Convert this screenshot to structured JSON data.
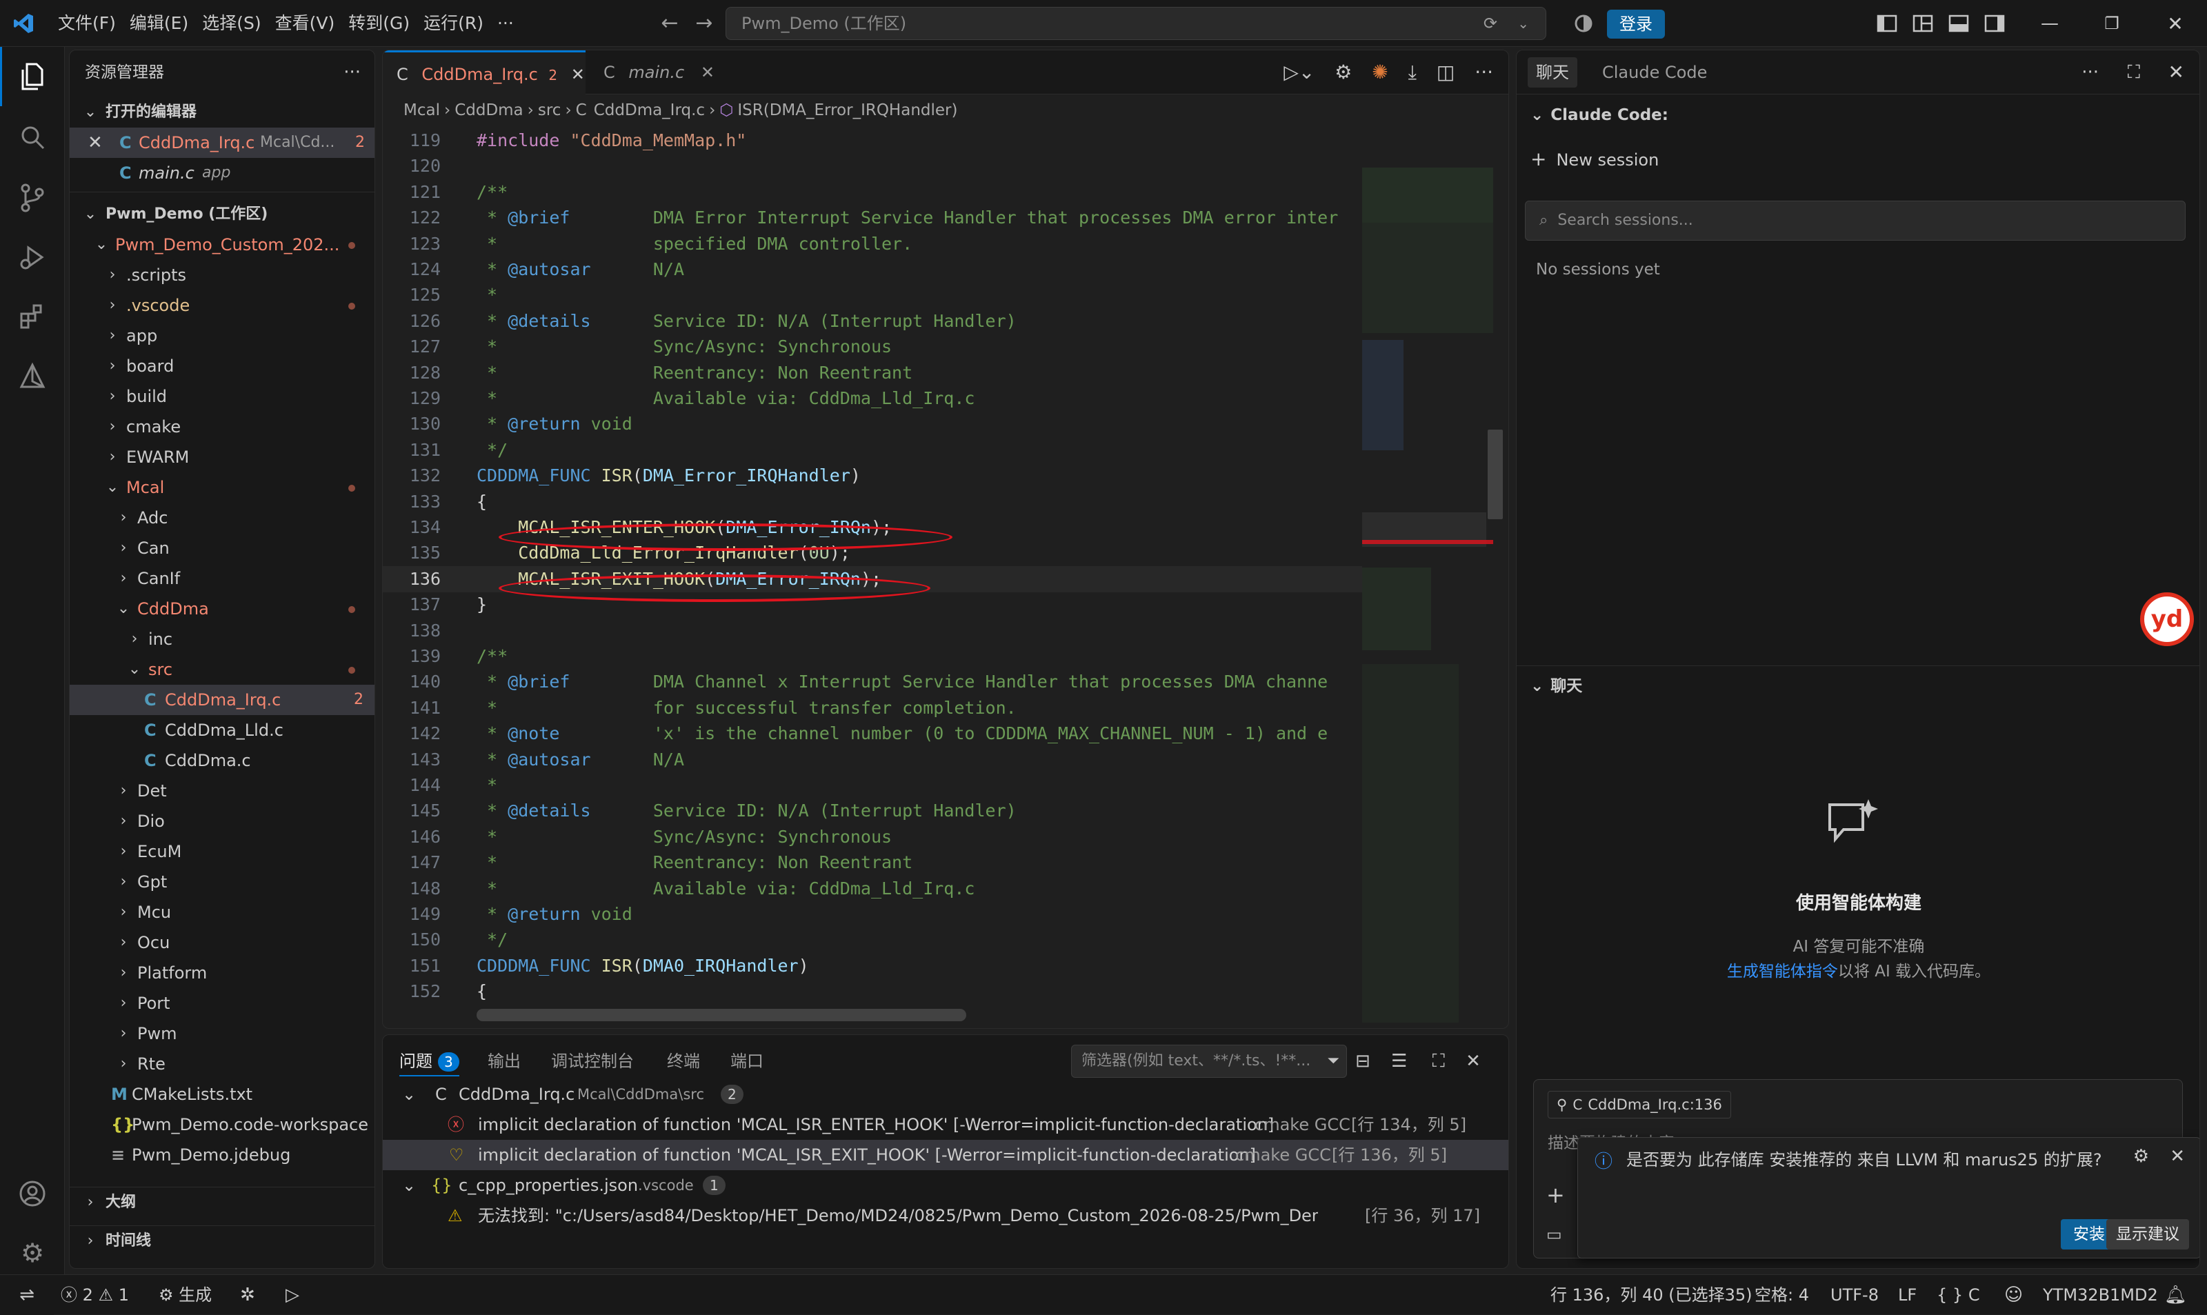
{
  "titlebar": {
    "menus": [
      "文件(F)",
      "编辑(E)",
      "选择(S)",
      "查看(V)",
      "转到(G)",
      "运行(R)",
      "···"
    ],
    "search": "Pwm_Demo (工作区)",
    "login": "登录"
  },
  "explorer": {
    "title": "资源管理器",
    "open_editors": "打开的编辑器",
    "open_items": [
      {
        "name": "CddDma_Irq.c",
        "path": "Mcal\\Cd...",
        "badge": "2"
      },
      {
        "name": "main.c",
        "path": "app"
      }
    ],
    "workspace": "Pwm_Demo (工作区)",
    "tree": [
      {
        "label": "Pwm_Demo_Custom_202...",
        "depth": 0,
        "open": true,
        "cls": "err",
        "dot": true
      },
      {
        "label": ".scripts",
        "depth": 1
      },
      {
        "label": ".vscode",
        "depth": 1,
        "cls": "mod",
        "dot": true
      },
      {
        "label": "app",
        "depth": 1
      },
      {
        "label": "board",
        "depth": 1
      },
      {
        "label": "build",
        "depth": 1
      },
      {
        "label": "cmake",
        "depth": 1
      },
      {
        "label": "EWARM",
        "depth": 1
      },
      {
        "label": "Mcal",
        "depth": 1,
        "open": true,
        "cls": "err",
        "dot": true
      },
      {
        "label": "Adc",
        "depth": 2
      },
      {
        "label": "Can",
        "depth": 2
      },
      {
        "label": "CanIf",
        "depth": 2
      },
      {
        "label": "CddDma",
        "depth": 2,
        "open": true,
        "cls": "err",
        "dot": true
      },
      {
        "label": "inc",
        "depth": 3
      },
      {
        "label": "src",
        "depth": 3,
        "open": true,
        "cls": "err",
        "dot": true
      },
      {
        "label": "CddDma_Irq.c",
        "depth": 4,
        "file": "c",
        "cls": "err",
        "badge": "2",
        "selected": true
      },
      {
        "label": "CddDma_Lld.c",
        "depth": 4,
        "file": "c"
      },
      {
        "label": "CddDma.c",
        "depth": 4,
        "file": "c"
      },
      {
        "label": "Det",
        "depth": 2
      },
      {
        "label": "Dio",
        "depth": 2
      },
      {
        "label": "EcuM",
        "depth": 2
      },
      {
        "label": "Gpt",
        "depth": 2
      },
      {
        "label": "Mcu",
        "depth": 2
      },
      {
        "label": "Ocu",
        "depth": 2
      },
      {
        "label": "Platform",
        "depth": 2
      },
      {
        "label": "Port",
        "depth": 2
      },
      {
        "label": "Pwm",
        "depth": 2
      },
      {
        "label": "Rte",
        "depth": 2
      },
      {
        "label": "CMakeLists.txt",
        "depth": 1,
        "file": "cmake"
      },
      {
        "label": "Pwm_Demo.code-workspace",
        "depth": 1,
        "file": "json"
      },
      {
        "label": "Pwm_Demo.jdebug",
        "depth": 1,
        "file": "txt"
      }
    ],
    "outline": "大纲",
    "timeline": "时间线"
  },
  "editor": {
    "tabs": [
      {
        "name": "CddDma_Irq.c",
        "badge": "2",
        "active": true
      },
      {
        "name": "main.c",
        "active": false
      }
    ],
    "breadcrumb": [
      "Mcal",
      "CddDma",
      "src",
      "CddDma_Irq.c",
      "ISR(DMA_Error_IRQHandler)"
    ],
    "current_line": "136",
    "lines": [
      {
        "n": "119",
        "t": [
          [
            "pp",
            "#include "
          ],
          [
            "str",
            "\"CddDma_MemMap.h\""
          ]
        ]
      },
      {
        "n": "120",
        "t": []
      },
      {
        "n": "121",
        "t": [
          [
            "cmt",
            "/**"
          ]
        ]
      },
      {
        "n": "122",
        "t": [
          [
            "cmt",
            " * "
          ],
          [
            "tag",
            "@brief"
          ],
          [
            "cmt",
            "        DMA Error Interrupt Service Handler that processes DMA error inter"
          ]
        ]
      },
      {
        "n": "123",
        "t": [
          [
            "cmt",
            " *               specified DMA controller."
          ]
        ]
      },
      {
        "n": "124",
        "t": [
          [
            "cmt",
            " * "
          ],
          [
            "tag",
            "@autosar"
          ],
          [
            "cmt",
            "      N/A"
          ]
        ]
      },
      {
        "n": "125",
        "t": [
          [
            "cmt",
            " *"
          ]
        ]
      },
      {
        "n": "126",
        "t": [
          [
            "cmt",
            " * "
          ],
          [
            "tag",
            "@details"
          ],
          [
            "cmt",
            "      Service ID: N/A (Interrupt Handler)"
          ]
        ]
      },
      {
        "n": "127",
        "t": [
          [
            "cmt",
            " *               Sync/Async: Synchronous"
          ]
        ]
      },
      {
        "n": "128",
        "t": [
          [
            "cmt",
            " *               Reentrancy: Non Reentrant"
          ]
        ]
      },
      {
        "n": "129",
        "t": [
          [
            "cmt",
            " *               Available via: CddDma_Lld_Irq.c"
          ]
        ]
      },
      {
        "n": "130",
        "t": [
          [
            "cmt",
            " * "
          ],
          [
            "tag",
            "@return"
          ],
          [
            "cmt",
            " void"
          ]
        ]
      },
      {
        "n": "131",
        "t": [
          [
            "cmt",
            " */"
          ]
        ]
      },
      {
        "n": "132",
        "t": [
          [
            "kw",
            "CDDDMA_FUNC "
          ],
          [
            "fn",
            "ISR"
          ],
          [
            "plain",
            "("
          ],
          [
            "id",
            "DMA_Error_IRQHandler"
          ],
          [
            "plain",
            ")"
          ]
        ]
      },
      {
        "n": "133",
        "t": [
          [
            "plain",
            "{"
          ]
        ]
      },
      {
        "n": "134",
        "t": [
          [
            "plain",
            "    "
          ],
          [
            "fn",
            "MCAL_ISR_ENTER_HOOK"
          ],
          [
            "plain",
            "("
          ],
          [
            "id",
            "DMA_Error_IRQn"
          ],
          [
            "plain",
            ");"
          ]
        ]
      },
      {
        "n": "135",
        "t": [
          [
            "plain",
            "    "
          ],
          [
            "fn",
            "CddDma_Lld_Error_IrqHandler"
          ],
          [
            "plain",
            "("
          ],
          [
            "num",
            "0U"
          ],
          [
            "plain",
            ");"
          ]
        ]
      },
      {
        "n": "136",
        "t": [
          [
            "plain",
            "    "
          ],
          [
            "fn",
            "MCAL_ISR_EXIT_HOOK"
          ],
          [
            "plain",
            "("
          ],
          [
            "id",
            "DMA_Error_IRQn"
          ],
          [
            "plain",
            ");"
          ]
        ]
      },
      {
        "n": "137",
        "t": [
          [
            "plain",
            "}"
          ]
        ]
      },
      {
        "n": "138",
        "t": []
      },
      {
        "n": "139",
        "t": [
          [
            "cmt",
            "/**"
          ]
        ]
      },
      {
        "n": "140",
        "t": [
          [
            "cmt",
            " * "
          ],
          [
            "tag",
            "@brief"
          ],
          [
            "cmt",
            "        DMA Channel x Interrupt Service Handler that processes DMA channe"
          ]
        ]
      },
      {
        "n": "141",
        "t": [
          [
            "cmt",
            " *               for successful transfer completion."
          ]
        ]
      },
      {
        "n": "142",
        "t": [
          [
            "cmt",
            " * "
          ],
          [
            "tag",
            "@note"
          ],
          [
            "cmt",
            "         'x' is the channel number (0 to CDDDMA_MAX_CHANNEL_NUM - 1) and e"
          ]
        ]
      },
      {
        "n": "143",
        "t": [
          [
            "cmt",
            " * "
          ],
          [
            "tag",
            "@autosar"
          ],
          [
            "cmt",
            "      N/A"
          ]
        ]
      },
      {
        "n": "144",
        "t": [
          [
            "cmt",
            " *"
          ]
        ]
      },
      {
        "n": "145",
        "t": [
          [
            "cmt",
            " * "
          ],
          [
            "tag",
            "@details"
          ],
          [
            "cmt",
            "      Service ID: N/A (Interrupt Handler)"
          ]
        ]
      },
      {
        "n": "146",
        "t": [
          [
            "cmt",
            " *               Sync/Async: Synchronous"
          ]
        ]
      },
      {
        "n": "147",
        "t": [
          [
            "cmt",
            " *               Reentrancy: Non Reentrant"
          ]
        ]
      },
      {
        "n": "148",
        "t": [
          [
            "cmt",
            " *               Available via: CddDma_Lld_Irq.c"
          ]
        ]
      },
      {
        "n": "149",
        "t": [
          [
            "cmt",
            " * "
          ],
          [
            "tag",
            "@return"
          ],
          [
            "cmt",
            " void"
          ]
        ]
      },
      {
        "n": "150",
        "t": [
          [
            "cmt",
            " */"
          ]
        ]
      },
      {
        "n": "151",
        "t": [
          [
            "kw",
            "CDDDMA_FUNC "
          ],
          [
            "fn",
            "ISR"
          ],
          [
            "plain",
            "("
          ],
          [
            "id",
            "DMA0_IRQHandler"
          ],
          [
            "plain",
            ")"
          ]
        ]
      },
      {
        "n": "152",
        "t": [
          [
            "plain",
            "{"
          ]
        ]
      }
    ]
  },
  "panel": {
    "tabs": [
      "问题",
      "输出",
      "调试控制台",
      "终端",
      "端口"
    ],
    "problem_count": "3",
    "filter_placeholder": "筛选器(例如 text、**/*.ts、!**...",
    "file1": {
      "name": "CddDma_Irq.c",
      "path": "Mcal\\CddDma\\src",
      "count": "2"
    },
    "issues": [
      {
        "text": "implicit declaration of function 'MCAL_ISR_ENTER_HOOK' [-Werror=implicit-function-declaration]",
        "source": "cmake GCC",
        "loc": "[行 134，列 5]"
      },
      {
        "text": "implicit declaration of function 'MCAL_ISR_EXIT_HOOK' [-Werror=implicit-function-declaration]",
        "source": "cmake GCC",
        "loc": "[行 136，列 5]"
      }
    ],
    "file2": {
      "name": "c_cpp_properties.json",
      "path": ".vscode",
      "count": "1"
    },
    "warning": {
      "text": "无法找到: \"c:/Users/asd84/Desktop/HET_Demo/MD24/0825/Pwm_Demo_Custom_2026-08-25/Pwm_Demo_C...",
      "loc": "[行 36，列 17]"
    }
  },
  "chat": {
    "tab_chat": "聊天",
    "tab_claude": "Claude Code",
    "section": "Claude Code:",
    "new_session": "New session",
    "search_placeholder": "Search sessions...",
    "no_sessions": "No sessions yet",
    "chat_header": "聊天",
    "build_title": "使用智能体构建",
    "ai_note": "AI 答复可能不准确",
    "link": "生成智能体指令",
    "link_tail": "以将 AI 载入代码库。",
    "context_chip": "CddDma_Irq.c:136",
    "input_placeholder": "描述要构建的内容",
    "notification": "是否要为 此存储库 安装推荐的 来自 LLVM 和 marus25 的扩展?",
    "install": "安装",
    "show_suggestions": "显示建议"
  },
  "status": {
    "errors": "2",
    "warnings": "1",
    "build": "生成",
    "position": "行 136，列 40 (已选择35)",
    "spaces": "空格: 4",
    "encoding": "UTF-8",
    "eol": "LF",
    "lang": "C",
    "device": "YTM32B1MD2"
  },
  "colors": {
    "accent": "#0078d4",
    "error": "#f14c4c",
    "annotation": "#e0141e"
  }
}
